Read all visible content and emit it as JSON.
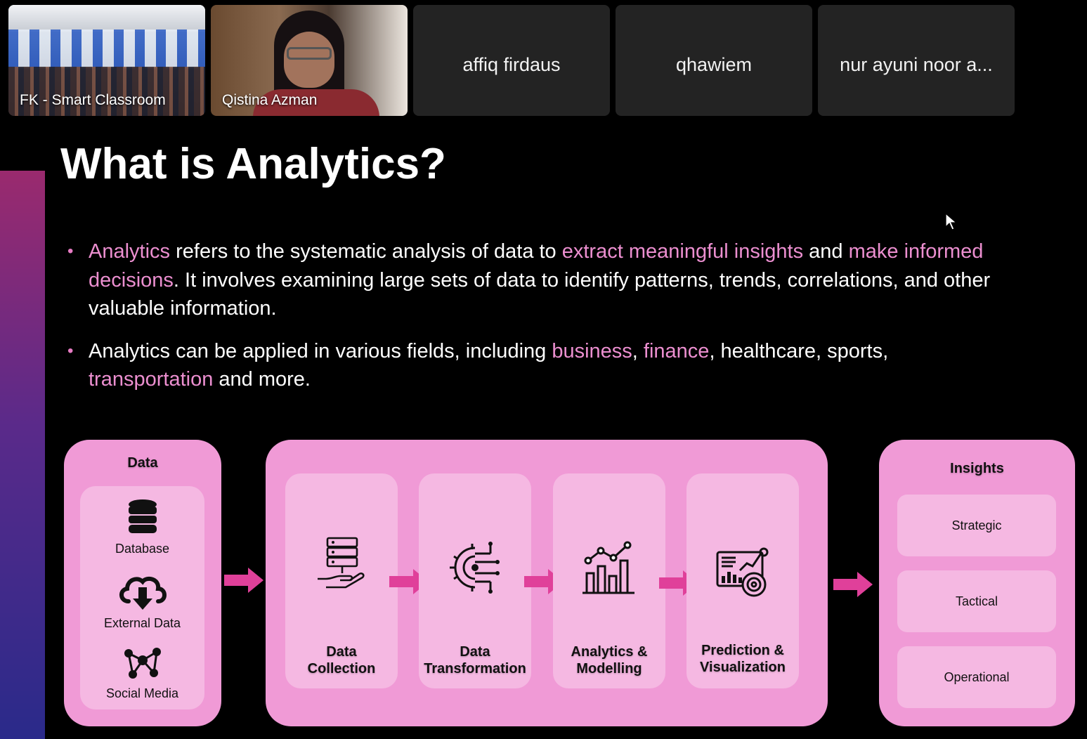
{
  "participants": [
    {
      "name": "FK - Smart Classroom",
      "video": true
    },
    {
      "name": "Qistina Azman",
      "video": true
    },
    {
      "name": "affiq firdaus",
      "video": false
    },
    {
      "name": "qhawiem",
      "video": false
    },
    {
      "name": "nur ayuni noor a...",
      "video": false
    }
  ],
  "slide": {
    "title": "What is Analytics?",
    "bullet1": {
      "t1": "Analytics",
      "t2": " refers to the systematic analysis of data to ",
      "t3": "extract meaningful insights",
      "t4": " and ",
      "t5": "make informed decisions",
      "t6": ". It involves examining large sets of data to identify patterns, trends, correlations, and other valuable information."
    },
    "bullet2": {
      "t1": "Analytics can be applied in various fields, including ",
      "t2": "business",
      "t3": ", ",
      "t4": "finance",
      "t5": ", healthcare, sports, ",
      "t6": "transportation",
      "t7": " and more."
    },
    "bullet_symbol": "•",
    "accent_color": "#ec8fd0"
  },
  "diagram": {
    "data_panel": {
      "title": "Data",
      "items": [
        {
          "label": "Database",
          "icon": "database-icon"
        },
        {
          "label": "External Data",
          "icon": "cloud-download-icon"
        },
        {
          "label": "Social Media",
          "icon": "network-icon"
        }
      ]
    },
    "process_steps": [
      {
        "label_line1": "Data",
        "label_line2": "Collection",
        "icon": "server-hand-icon"
      },
      {
        "label_line1": "Data",
        "label_line2": "Transformation",
        "icon": "gear-circuit-icon"
      },
      {
        "label_line1": "Analytics &",
        "label_line2": "Modelling",
        "icon": "bar-chart-icon"
      },
      {
        "label_line1": "Prediction &",
        "label_line2": "Visualization",
        "icon": "dashboard-icon"
      }
    ],
    "insights_panel": {
      "title": "Insights",
      "items": [
        "Strategic",
        "Tactical",
        "Operational"
      ]
    },
    "panel_color": "#f09ad6",
    "inner_color": "#f5b8e2",
    "arrow_color": "#e0409a"
  }
}
